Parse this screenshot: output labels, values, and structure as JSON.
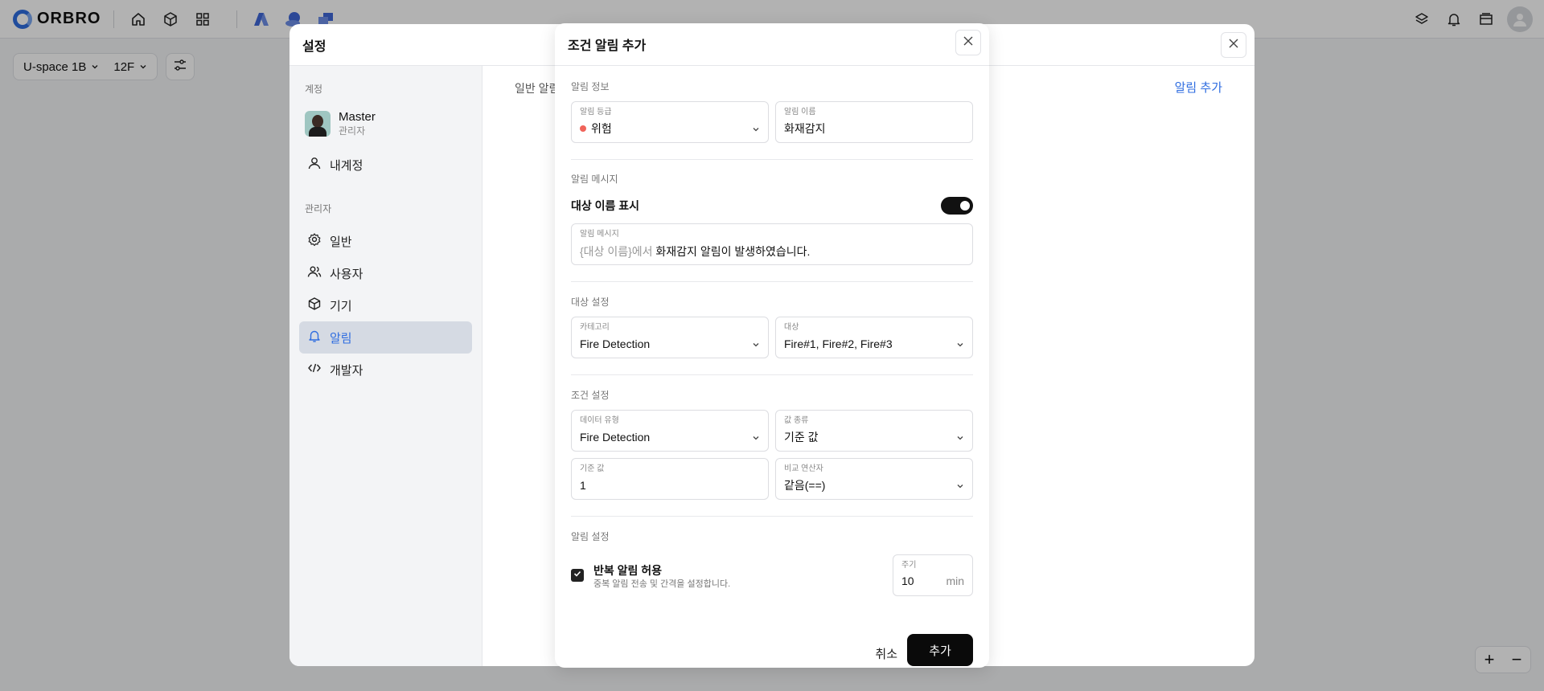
{
  "topbar": {
    "brand": "ORBRO",
    "icons": [
      "home-icon",
      "cube-icon",
      "grid-icon",
      "app-icon-a",
      "app-icon-b",
      "app-icon-c"
    ],
    "right_icons": [
      "layers-icon",
      "bell-icon",
      "archive-icon",
      "user-avatar-icon"
    ]
  },
  "floorbar": {
    "building": "U-space 1B",
    "floor": "12F"
  },
  "settings": {
    "title": "설정",
    "account_section": "계정",
    "user_name": "Master",
    "user_role": "관리자",
    "my_account": "내계정",
    "admin_section": "관리자",
    "menu": [
      "일반",
      "사용자",
      "기기",
      "알림",
      "개발자"
    ],
    "active_menu": "알림",
    "main_tab": "일반 알림",
    "add_alert": "알림 추가"
  },
  "modal": {
    "title": "조건 알림 추가",
    "alert_info": {
      "section": "알림 정보",
      "grade_label": "알림 등급",
      "grade_value": "위험",
      "name_label": "알림 이름",
      "name_value": "화재감지"
    },
    "alert_message": {
      "section": "알림 메시지",
      "toggle_label": "대상 이름 표시",
      "toggle_on": true,
      "field_label": "알림 메시지",
      "token": "{대상 이름}에서",
      "text": " 화재감지 알림이 발생하였습니다."
    },
    "target": {
      "section": "대상 설정",
      "category_label": "카테고리",
      "category_value": "Fire Detection",
      "target_label": "대상",
      "target_value": "Fire#1, Fire#2, Fire#3"
    },
    "condition": {
      "section": "조건 설정",
      "data_type_label": "데이터 유형",
      "data_type_value": "Fire Detection",
      "value_kind_label": "값 종류",
      "value_kind_value": "기준 값",
      "base_label": "기준 값",
      "base_value": "1",
      "operator_label": "비교 연산자",
      "operator_value": "같음(==)"
    },
    "alert_setting": {
      "section": "알림 설정",
      "repeat_title": "반복 알림 허용",
      "repeat_desc": "중복 알림 전송 및 간격을 설정합니다.",
      "repeat_checked": true,
      "period_label": "주기",
      "period_value": "10",
      "period_unit": "min"
    },
    "cancel": "취소",
    "submit": "추가"
  },
  "zoom": {
    "plus": "+",
    "minus": "−"
  },
  "colors": {
    "accent": "#2f6de0",
    "danger": "#f0645a",
    "primary_button": "#0a0a0a"
  }
}
